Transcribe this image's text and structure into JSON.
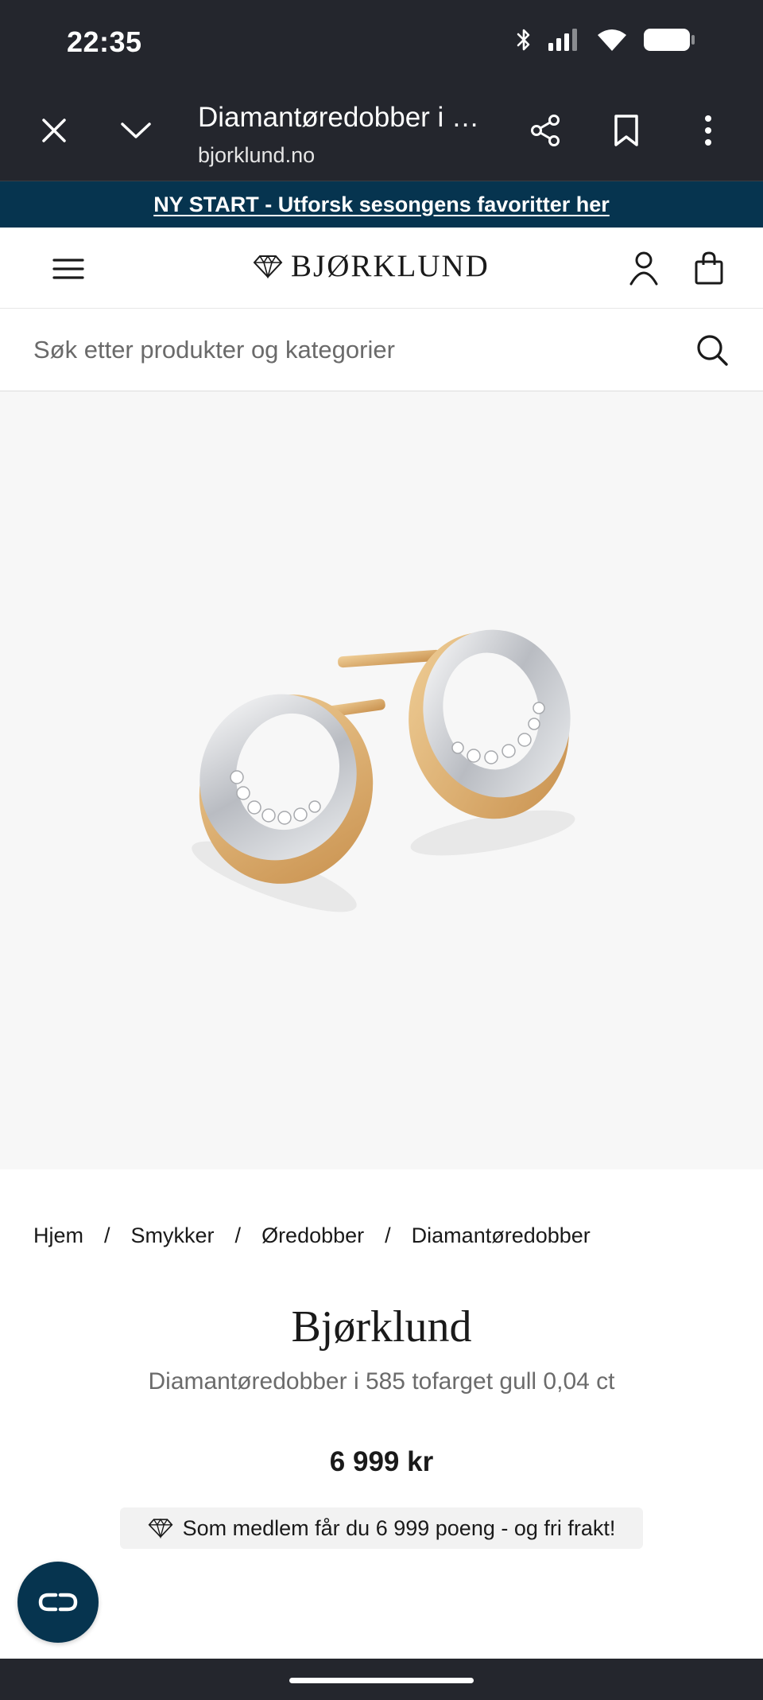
{
  "status_bar": {
    "time": "22:35",
    "icons": [
      "bluetooth-icon",
      "signal-icon",
      "wifi-icon",
      "battery-icon"
    ]
  },
  "browser": {
    "page_title": "Diamantøredobber i 585 tofarget gull 0,04 ct",
    "domain": "bjorklund.no",
    "icons": [
      "close-icon",
      "chevron-down-icon",
      "share-icon",
      "bookmark-icon",
      "more-vert-icon"
    ]
  },
  "promo": {
    "text": "NY START - Utforsk sesongens favoritter her"
  },
  "header": {
    "logo_text": "BJØRKLUND",
    "icons": [
      "menu-icon",
      "diamond-icon",
      "account-icon",
      "cart-icon"
    ]
  },
  "search": {
    "placeholder": "Søk etter produkter og kategorier",
    "value": ""
  },
  "breadcrumb": [
    "Hjem",
    "Smykker",
    "Øredobber",
    "Diamantøredobber"
  ],
  "product": {
    "brand": "Bjørklund",
    "name": "Diamantøredobber i 585 tofarget gull 0,04 ct",
    "price": "6 999 kr",
    "member_text": "Som medlem får du 6 999 poeng - og fri frakt!"
  },
  "colors": {
    "chrome_bg": "#24262d",
    "brand_navy": "#06344f",
    "image_bg": "#f7f7f7",
    "gold": "#d9a968",
    "silver": "#c9ccd1"
  }
}
